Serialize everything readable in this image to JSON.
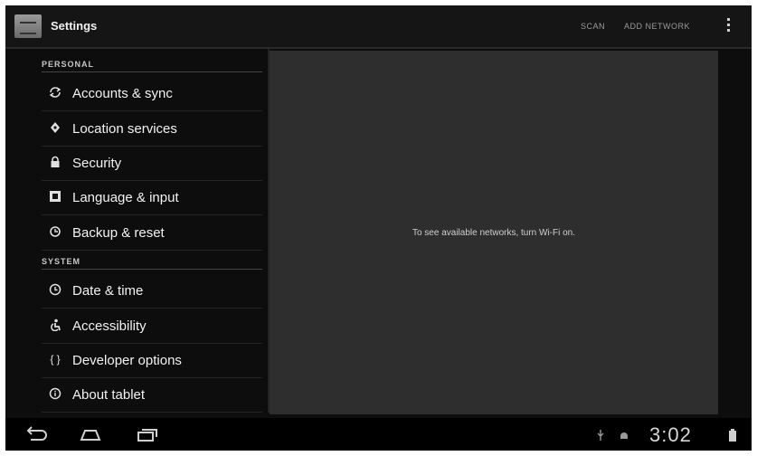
{
  "action_bar": {
    "title": "Settings",
    "actions": [
      "SCAN",
      "ADD NETWORK"
    ]
  },
  "sections": {
    "personal": "PERSONAL",
    "system": "SYSTEM"
  },
  "personal_items": [
    {
      "label": "Accounts & sync",
      "icon": "sync-icon"
    },
    {
      "label": "Location services",
      "icon": "location-icon"
    },
    {
      "label": "Security",
      "icon": "lock-icon"
    },
    {
      "label": "Language & input",
      "icon": "language-icon"
    },
    {
      "label": "Backup & reset",
      "icon": "backup-icon"
    }
  ],
  "system_items": [
    {
      "label": "Date & time",
      "icon": "clock-icon"
    },
    {
      "label": "Accessibility",
      "icon": "accessibility-icon"
    },
    {
      "label": "Developer options",
      "icon": "braces-icon"
    },
    {
      "label": "About tablet",
      "icon": "info-icon"
    }
  ],
  "detail": {
    "message": "To see available networks, turn Wi-Fi on."
  },
  "status_bar": {
    "time": "3:02"
  },
  "nav_icons": [
    "back-icon",
    "home-icon",
    "recent-apps-icon"
  ]
}
